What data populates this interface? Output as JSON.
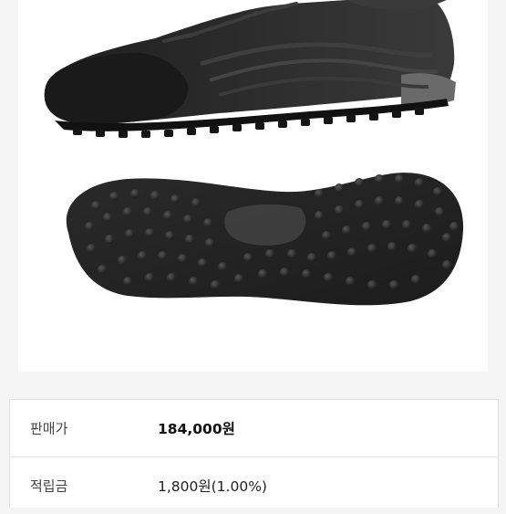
{
  "product_image": {
    "alt_icon": "football-turf-shoe-image",
    "background": "#ffffff"
  },
  "info": {
    "sale_price_label": "판매가",
    "sale_price_value": "184,000원",
    "points_label": "적립금",
    "points_value": "1,800원(1.00%)"
  },
  "colors": {
    "page_bg": "#f5f5f5",
    "shoe_dark": "#2b2b2b",
    "text": "#222222"
  }
}
